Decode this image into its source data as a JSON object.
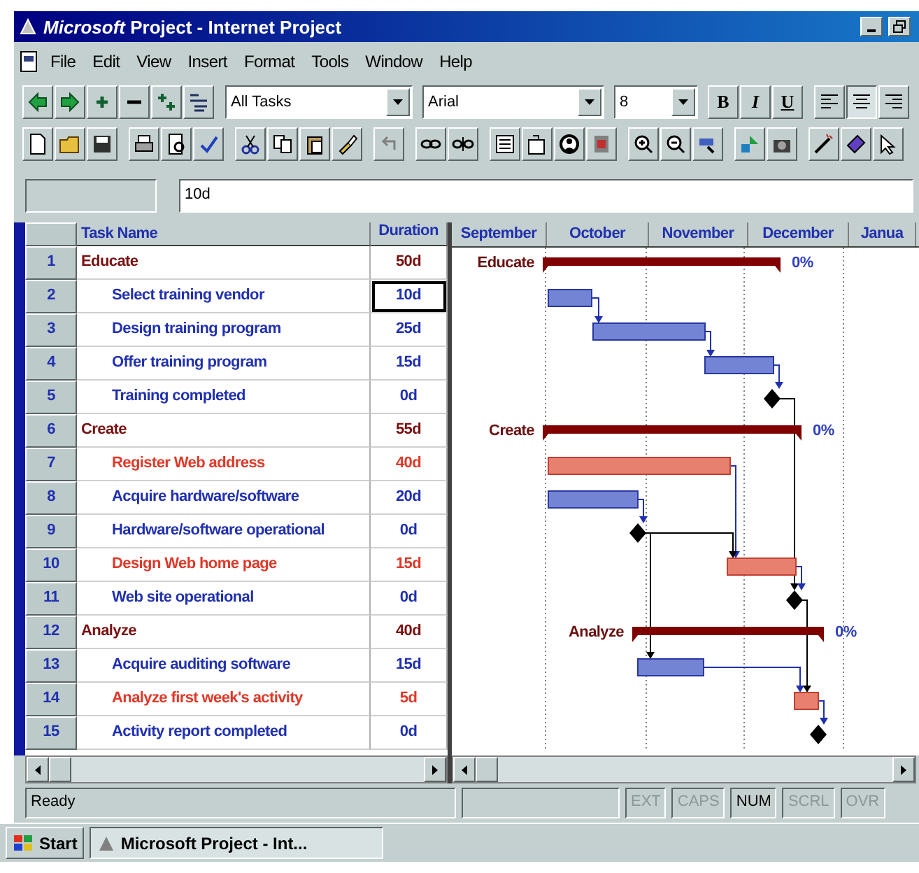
{
  "window": {
    "title": "*Microsoft* Project - Internet Project"
  },
  "menu": [
    "File",
    "Edit",
    "View",
    "Insert",
    "Format",
    "Tools",
    "Window",
    "Help"
  ],
  "format_toolbar": {
    "filter": "All Tasks",
    "font": "Arial",
    "size": "8",
    "style_buttons": [
      {
        "label": "B",
        "selected": false
      },
      {
        "label": "I",
        "selected": false
      },
      {
        "label": "U",
        "selected": false
      }
    ],
    "align_buttons": [
      {
        "selected": false
      },
      {
        "selected": true
      },
      {
        "selected": false
      }
    ]
  },
  "entry_bar": {
    "value": "10d"
  },
  "table": {
    "columns": [
      "Task Name",
      "Duration"
    ],
    "rows": [
      {
        "id": "1",
        "name": "Educate",
        "duration": "50d",
        "kind": "summary",
        "active": false,
        "bar_label": "Educate",
        "percent": "0%"
      },
      {
        "id": "2",
        "name": "Select training vendor",
        "duration": "10d",
        "kind": "task",
        "critical": false,
        "active": true
      },
      {
        "id": "3",
        "name": "Design training program",
        "duration": "25d",
        "kind": "task",
        "critical": false,
        "active": false
      },
      {
        "id": "4",
        "name": "Offer training program",
        "duration": "15d",
        "kind": "task",
        "critical": false,
        "active": false
      },
      {
        "id": "5",
        "name": "Training completed",
        "duration": "0d",
        "kind": "milestone",
        "critical": false,
        "active": false
      },
      {
        "id": "6",
        "name": "Create",
        "duration": "55d",
        "kind": "summary",
        "active": false,
        "bar_label": "Create",
        "percent": "0%"
      },
      {
        "id": "7",
        "name": "Register Web address",
        "duration": "40d",
        "kind": "task",
        "critical": true,
        "active": false
      },
      {
        "id": "8",
        "name": "Acquire hardware/software",
        "duration": "20d",
        "kind": "task",
        "critical": false,
        "active": false
      },
      {
        "id": "9",
        "name": "Hardware/software operational",
        "duration": "0d",
        "kind": "milestone",
        "critical": false,
        "active": false
      },
      {
        "id": "10",
        "name": "Design Web home page",
        "duration": "15d",
        "kind": "task",
        "critical": true,
        "active": false
      },
      {
        "id": "11",
        "name": "Web site operational",
        "duration": "0d",
        "kind": "milestone",
        "critical": false,
        "active": false
      },
      {
        "id": "12",
        "name": "Analyze",
        "duration": "40d",
        "kind": "summary",
        "active": false,
        "bar_label": "Analyze",
        "percent": "0%"
      },
      {
        "id": "13",
        "name": "Acquire auditing software",
        "duration": "15d",
        "kind": "task",
        "critical": false,
        "active": false
      },
      {
        "id": "14",
        "name": "Analyze first week's activity",
        "duration": "5d",
        "kind": "task",
        "critical": true,
        "active": false
      },
      {
        "id": "15",
        "name": "Activity report completed",
        "duration": "0d",
        "kind": "milestone",
        "critical": false,
        "active": false
      }
    ]
  },
  "gantt": {
    "months": [
      "September",
      "October",
      "November",
      "December",
      "Janua"
    ]
  },
  "status_bar": {
    "message": "Ready",
    "indicators": [
      {
        "label": "EXT",
        "on": false
      },
      {
        "label": "CAPS",
        "on": false
      },
      {
        "label": "NUM",
        "on": true
      },
      {
        "label": "SCRL",
        "on": false
      },
      {
        "label": "OVR",
        "on": false
      }
    ]
  },
  "taskbar": {
    "start": "Start",
    "tasks": [
      {
        "label": "Microsoft Project - Int...",
        "selected": true
      }
    ]
  }
}
